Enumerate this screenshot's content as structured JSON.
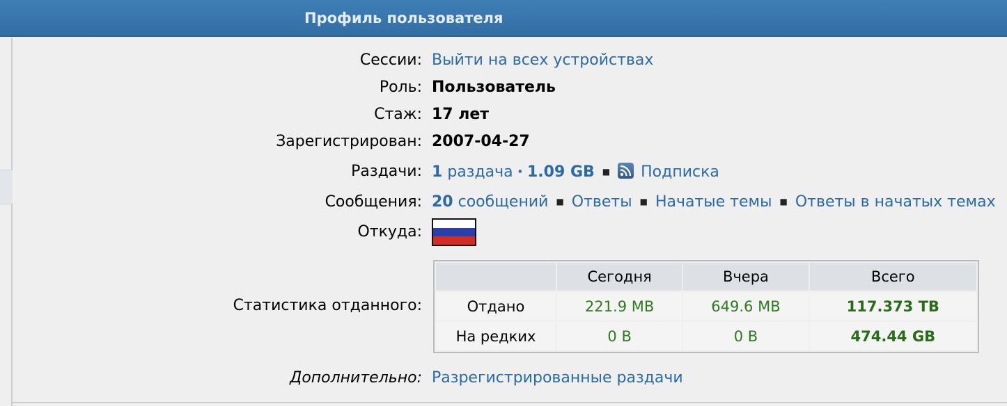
{
  "header": {
    "title": "Профиль пользователя"
  },
  "profile": {
    "sessions": {
      "label": "Сессии:",
      "link": "Выйти на всех устройствах"
    },
    "role": {
      "label": "Роль:",
      "value": "Пользователь"
    },
    "tenure": {
      "label": "Стаж:",
      "value": "17 лет"
    },
    "registered": {
      "label": "Зарегистрирован:",
      "value": "2007-04-27"
    },
    "releases": {
      "label": "Раздачи:",
      "count": "1",
      "count_text": "раздача",
      "sep": "·",
      "size": "1.09 GB",
      "subscribe": "Подписка"
    },
    "messages": {
      "label": "Сообщения:",
      "count": "20",
      "count_text": "сообщений",
      "replies": "Ответы",
      "started_topics": "Начатые темы",
      "replies_in_started": "Ответы в начатых темах"
    },
    "from": {
      "label": "Откуда:",
      "flag": "russia-flag"
    },
    "stats": {
      "label": "Статистика отданного:",
      "columns": [
        "",
        "Сегодня",
        "Вчера",
        "Всего"
      ],
      "rows": [
        {
          "name": "Отдано",
          "today": "221.9 MB",
          "yesterday": "649.6 MB",
          "total": "117.373 TB"
        },
        {
          "name": "На редких",
          "today": "0 B",
          "yesterday": "0 B",
          "total": "474.44 GB"
        }
      ]
    },
    "extra": {
      "label": "Дополнительно:",
      "link": "Разрегистрированные раздачи"
    }
  },
  "colors": {
    "header": "#3a77ae",
    "link": "#2a6aa6",
    "green": "#2d7a1f"
  }
}
